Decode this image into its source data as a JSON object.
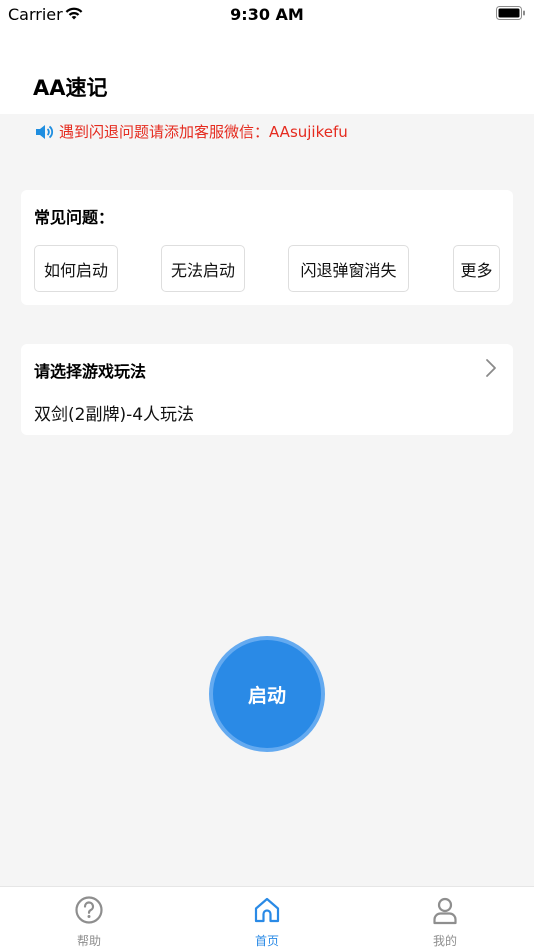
{
  "status_bar": {
    "carrier": "Carrier",
    "time": "9:30 AM"
  },
  "header": {
    "title": "AA速记"
  },
  "notice": {
    "text": "遇到闪退问题请添加客服微信：AAsujikefu",
    "color": "#e52b1f"
  },
  "faq": {
    "title": "常见问题：",
    "buttons": [
      "如何启动",
      "无法启动",
      "闪退弹窗消失",
      "更多"
    ]
  },
  "game_mode": {
    "title": "请选择游戏玩法",
    "value": "双剑(2副牌)-4人玩法"
  },
  "start_button": {
    "label": "启动",
    "color": "#2a8ae6"
  },
  "tabs": [
    {
      "label": "帮助",
      "icon": "help-icon",
      "active": false
    },
    {
      "label": "首页",
      "icon": "home-icon",
      "active": true
    },
    {
      "label": "我的",
      "icon": "person-icon",
      "active": false
    }
  ],
  "colors": {
    "accent": "#2a8ae6",
    "tab_inactive": "#8e8e8e",
    "background": "#f5f5f5"
  }
}
